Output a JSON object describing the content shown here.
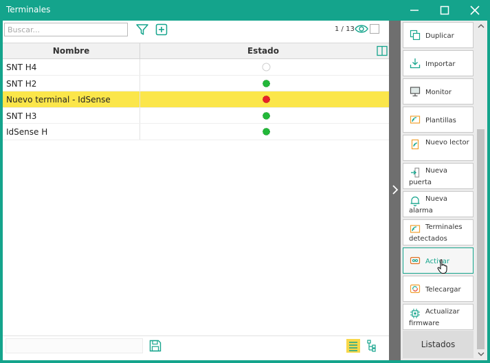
{
  "window": {
    "title": "Terminales"
  },
  "toolbar": {
    "search_placeholder": "Buscar...",
    "pager": "1 / 13"
  },
  "grid": {
    "columns": [
      "Nombre",
      "Estado"
    ],
    "rows": [
      {
        "name": "SNT H4",
        "status": "offline",
        "color": "#ffffff"
      },
      {
        "name": "SNT H2",
        "status": "online",
        "color": "#22b839"
      },
      {
        "name": "Nuevo terminal - IdSense",
        "status": "error",
        "color": "#e8202a",
        "selected": true
      },
      {
        "name": "SNT H3",
        "status": "online",
        "color": "#22b839"
      },
      {
        "name": "IdSense H",
        "status": "online",
        "color": "#22b839"
      }
    ]
  },
  "actions": [
    {
      "label": "Duplicar",
      "icon": "duplicate-icon"
    },
    {
      "label": "Importar",
      "icon": "download-icon"
    },
    {
      "label": "Monitor",
      "icon": "monitor-icon"
    },
    {
      "label": "Plantillas",
      "icon": "rss-card-icon"
    },
    {
      "label": "Nuevo lector",
      "icon": "reader-icon"
    },
    {
      "label": "Nueva puerta",
      "icon": "door-icon"
    },
    {
      "label": "Nueva alarma",
      "icon": "bell-icon"
    },
    {
      "label": "Terminales detectados",
      "icon": "rss-card-icon"
    },
    {
      "label": "Activar",
      "icon": "activate-icon",
      "active": true
    },
    {
      "label": "Telecargar",
      "icon": "sync-icon"
    },
    {
      "label": "Actualizar firmware",
      "icon": "chip-icon"
    }
  ],
  "listados": "Listados",
  "colors": {
    "accent": "#14a48c",
    "selected_row": "#fbe64a"
  }
}
